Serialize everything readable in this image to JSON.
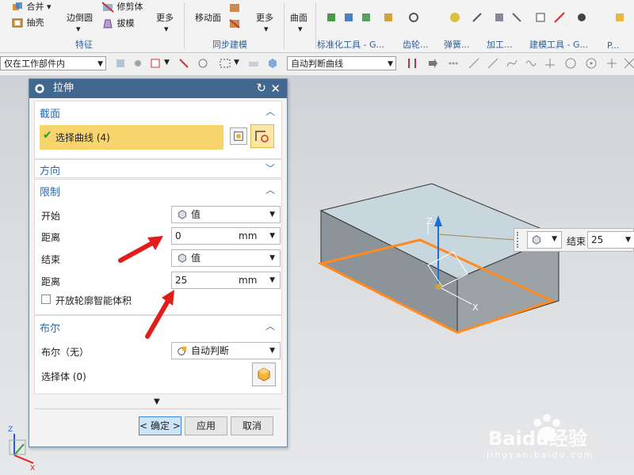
{
  "ribbon": {
    "feature_group": {
      "merge": "合并",
      "shell": "抽壳",
      "edge_blend": "边倒圆",
      "trim_body": "修剪体",
      "draft": "拔模",
      "more": "更多",
      "label": "特征"
    },
    "sync_group": {
      "move_face": "移动面",
      "more": "更多",
      "label": "同步建模"
    },
    "surface": "曲面",
    "group_labels": [
      "标准化工具 - G...",
      "齿轮...",
      "弹簧...",
      "加工...",
      "建模工具 - G...",
      "P..."
    ]
  },
  "selection_bar": {
    "filter": "仅在工作部件内",
    "curve_rule": "自动判断曲线"
  },
  "dialog": {
    "title": "拉伸",
    "section": {
      "header": "截面",
      "select_curve": "选择曲线 (4)"
    },
    "direction": {
      "header": "方向"
    },
    "limits": {
      "header": "限制",
      "start_label": "开始",
      "start_value": "值",
      "distance1_label": "距离",
      "distance1_value": "0",
      "distance1_unit": "mm",
      "end_label": "结束",
      "end_value": "值",
      "distance2_label": "距离",
      "distance2_value": "25",
      "distance2_unit": "mm",
      "open_profile": "开放轮廓智能体积"
    },
    "boolean": {
      "header": "布尔",
      "boolean_label": "布尔（无）",
      "boolean_value": "自动判断",
      "select_body": "选择体 (0)"
    },
    "buttons": {
      "ok": "< 确定 >",
      "apply": "应用",
      "cancel": "取消"
    }
  },
  "floating": {
    "end_label": "结束",
    "end_value": "25"
  },
  "viewport": {
    "axis_z": "Z",
    "axis_x": "X"
  },
  "watermark": {
    "brand": "Baidu经验",
    "url": "jingyan.baidu.com"
  },
  "colors": {
    "title_bar": "#43688f",
    "header_text": "#2d6aa8",
    "selection_highlight": "#f7d56c",
    "arrow_red": "#e21b1b",
    "edge_orange": "#ff8a1f"
  }
}
